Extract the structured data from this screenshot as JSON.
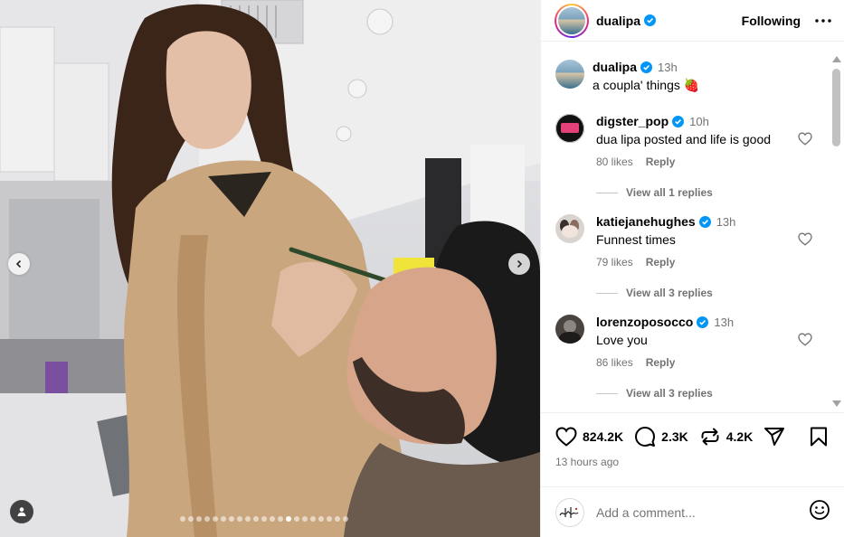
{
  "post": {
    "username": "dualipa",
    "follow_state": "Following",
    "more_icon": "more-horizontal-icon",
    "verified_icon": "verified-badge-icon",
    "carousel": {
      "slide_count": 21,
      "active_index": 13
    }
  },
  "caption": {
    "username": "dualipa",
    "time": "13h",
    "text": "a coupla' things 🍓"
  },
  "comments": [
    {
      "username": "digster_pop",
      "time": "10h",
      "text": "dua lipa posted and life is good",
      "likes": "80 likes",
      "reply_label": "Reply",
      "view_replies": "View all 1 replies"
    },
    {
      "username": "katiejanehughes",
      "time": "13h",
      "text": "Funnest times",
      "likes": "79 likes",
      "reply_label": "Reply",
      "view_replies": "View all 3 replies"
    },
    {
      "username": "lorenzoposocco",
      "time": "13h",
      "text": "Love you",
      "likes": "86 likes",
      "reply_label": "Reply",
      "view_replies": "View all 3 replies"
    }
  ],
  "actions": {
    "likes": "824.2K",
    "comments": "2.3K",
    "reposts": "4.2K",
    "posted": "13 hours ago"
  },
  "composer": {
    "placeholder": "Add a comment..."
  },
  "colors": {
    "verified": "#0095f6",
    "muted": "#737373",
    "divider": "#efefef"
  }
}
